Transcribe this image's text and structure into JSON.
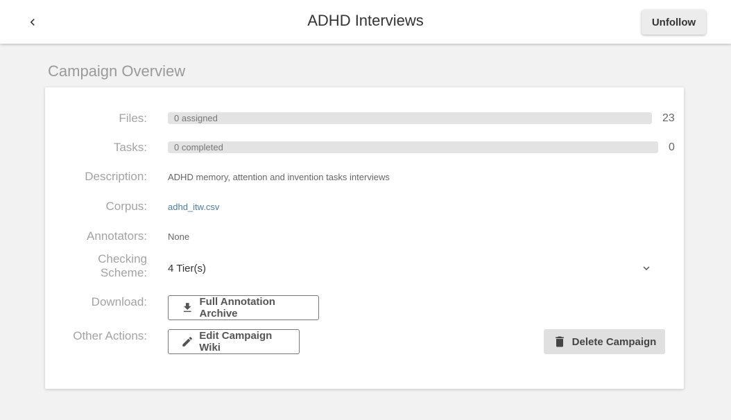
{
  "header": {
    "title": "ADHD Interviews",
    "follow_button": "Unfollow"
  },
  "overview": {
    "section_title": "Campaign Overview",
    "files": {
      "label": "Files:",
      "bar_text": "0 assigned",
      "total": "23",
      "progress": 0
    },
    "tasks": {
      "label": "Tasks:",
      "bar_text": "0 completed",
      "total": "0",
      "progress": 0
    },
    "description": {
      "label": "Description:",
      "value": "ADHD memory, attention and invention tasks interviews"
    },
    "corpus": {
      "label": "Corpus:",
      "value": "adhd_itw.csv"
    },
    "annotators": {
      "label": "Annotators:",
      "value": "None"
    },
    "checking_scheme": {
      "label_line1": "Checking",
      "label_line2": "Scheme:",
      "value": "4 Tier(s)"
    },
    "download": {
      "label": "Download:",
      "button": "Full Annotation Archive"
    },
    "other_actions": {
      "label": "Other Actions:",
      "edit_button": "Edit Campaign Wiki",
      "delete_button": "Delete Campaign"
    }
  }
}
